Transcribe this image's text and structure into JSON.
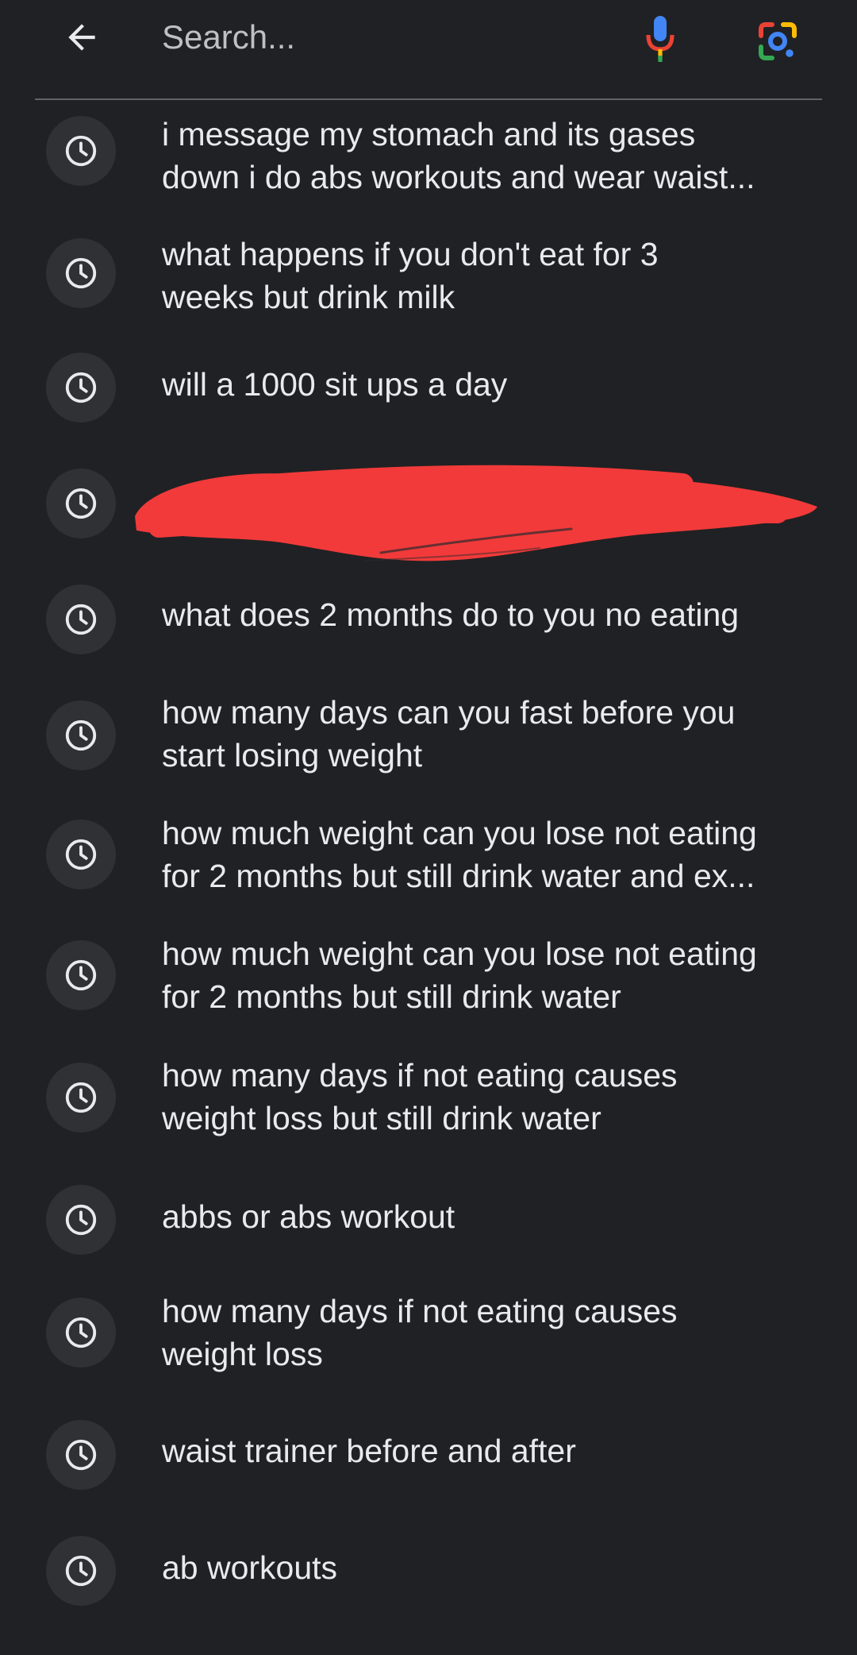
{
  "search": {
    "placeholder": "Search...",
    "back_icon": "arrow-back-icon",
    "mic_icon": "mic-icon",
    "lens_icon": "google-lens-icon"
  },
  "colors": {
    "background": "#202124",
    "text": "#e8eaed",
    "icon_circle": "#303134",
    "divider": "#5f6368",
    "redaction": "#f23a3a"
  },
  "history": [
    {
      "icon": "history-clock-icon",
      "text": "i message my stomach and its gases\ndown i do abs workouts and wear waist..."
    },
    {
      "icon": "history-clock-icon",
      "text": "what happens if you don't eat for 3\nweeks but drink milk"
    },
    {
      "icon": "history-clock-icon",
      "text": "will a 1000 sit ups a day"
    },
    {
      "icon": "history-clock-icon",
      "text": ""
    },
    {
      "icon": "history-clock-icon",
      "text": "what does 2 months do to you no eating"
    },
    {
      "icon": "history-clock-icon",
      "text": "how many days can you fast before you\nstart losing weight"
    },
    {
      "icon": "history-clock-icon",
      "text": "how much weight can you lose not eating\nfor 2 months but still drink water and ex..."
    },
    {
      "icon": "history-clock-icon",
      "text": "how much weight can you lose not eating\nfor 2 months but still drink water"
    },
    {
      "icon": "history-clock-icon",
      "text": "how many days if not eating causes\nweight loss but still drink water"
    },
    {
      "icon": "history-clock-icon",
      "text": "abbs or abs workout"
    },
    {
      "icon": "history-clock-icon",
      "text": "how many days if not eating causes\nweight loss"
    },
    {
      "icon": "history-clock-icon",
      "text": "waist trainer before and after"
    },
    {
      "icon": "history-clock-icon",
      "text": "ab workouts"
    }
  ]
}
